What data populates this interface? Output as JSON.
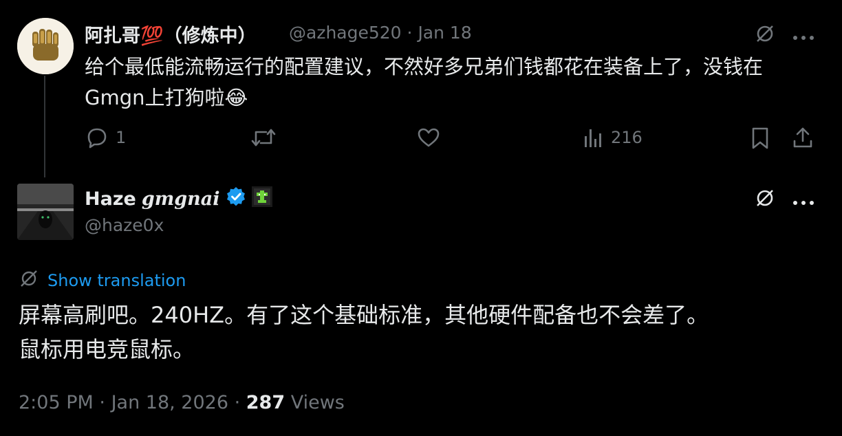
{
  "tweet1": {
    "name": "阿扎哥💯（修炼中）",
    "handle": "@azhage520",
    "date": "Jan 18",
    "text_line1": "给个最低能流畅运行的配置建议，不然好多兄弟们钱都花在装备上了，没钱在",
    "text_line2": "Gmgn上打狗啦😂",
    "replies": "1",
    "views": "216"
  },
  "tweet2": {
    "name": "Haze",
    "name_script": "gmgnai",
    "handle": "@haze0x",
    "translate_label": "Show translation",
    "text_line1": "屏幕高刷吧。240HZ。有了这个基础标准，其他硬件配备也不会差了。",
    "text_line2": "鼠标用电竞鼠标。",
    "time": "2:05 PM",
    "date": "Jan 18, 2026",
    "views_count": "287",
    "views_label": "Views"
  },
  "colors": {
    "background": "#000000",
    "text": "#e7e9ea",
    "muted": "#71767b",
    "link": "#1d9bf0",
    "verified": "#1d9bf0"
  },
  "icons": [
    "grok-icon",
    "more-icon",
    "reply-icon",
    "retweet-icon",
    "like-icon",
    "views-icon",
    "bookmark-icon",
    "share-icon",
    "verified-badge-icon",
    "translate-icon"
  ]
}
